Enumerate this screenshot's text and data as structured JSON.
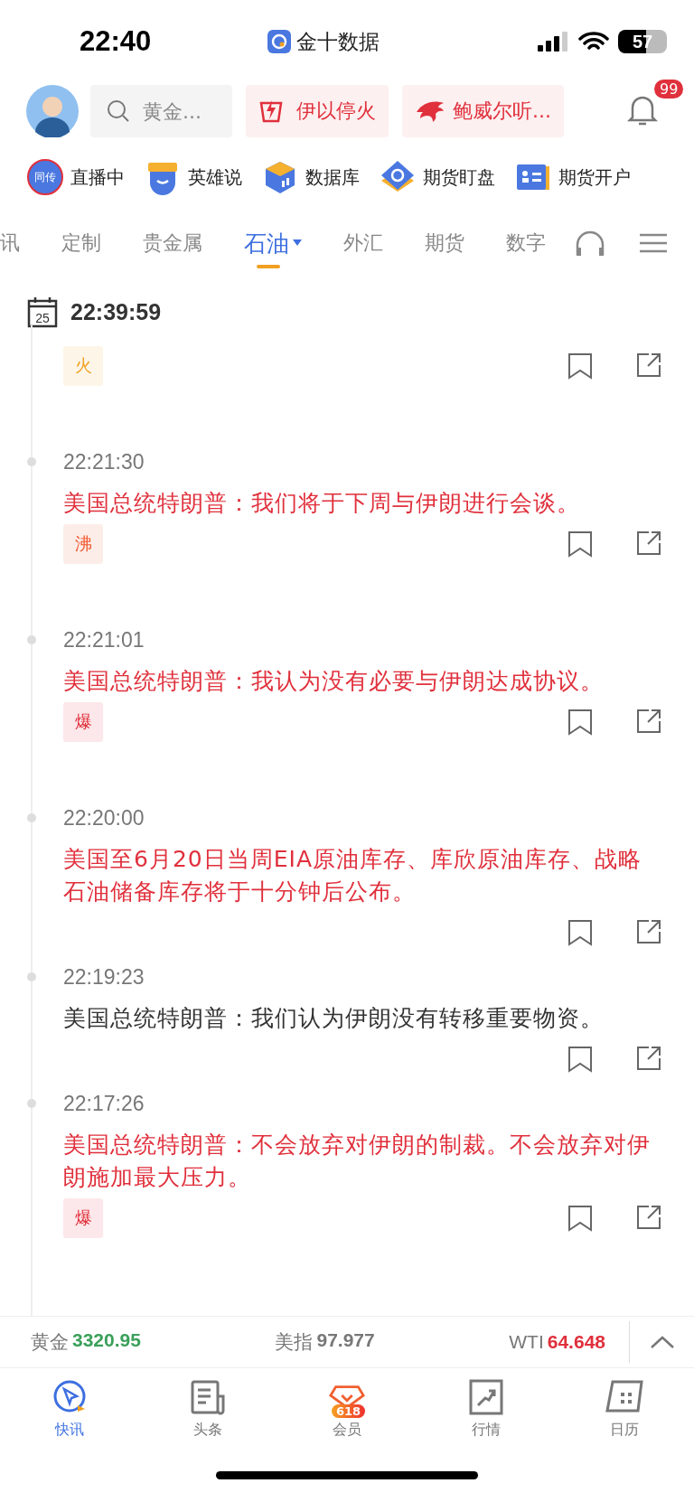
{
  "status_bar": {
    "time": "22:40",
    "app": "金十数据",
    "battery": "57"
  },
  "top_bar": {
    "search": {
      "placeholder": "黄金..."
    },
    "topics": [
      {
        "label": "伊以停火",
        "kind": "fire"
      },
      {
        "label": "鲍威尔听...",
        "kind": "eagle"
      }
    ],
    "notifications": "99"
  },
  "shortcuts": [
    {
      "label": "直播中",
      "kind": "live",
      "badge": "同传"
    },
    {
      "label": "英雄说",
      "kind": "hero"
    },
    {
      "label": "数据库",
      "kind": "database"
    },
    {
      "label": "期货盯盘",
      "kind": "watch"
    },
    {
      "label": "期货开户",
      "kind": "account"
    }
  ],
  "tabs": [
    {
      "label": "讯",
      "selected": false
    },
    {
      "label": "定制",
      "selected": false
    },
    {
      "label": "贵金属",
      "selected": false
    },
    {
      "label": "石油",
      "selected": true,
      "dropdown": true
    },
    {
      "label": "外汇",
      "selected": false
    },
    {
      "label": "期货",
      "selected": false
    },
    {
      "label": "数字",
      "selected": false
    }
  ],
  "feed": {
    "date": "25",
    "time": "22:39:59",
    "items": [
      {
        "tag": {
          "text": "火",
          "color": "#f0a020"
        }
      },
      {
        "time": "22:21:30",
        "text": "美国总统特朗普：我们将于下周与伊朗进行会谈。",
        "important": true,
        "tag": {
          "text": "沸",
          "color": "#f05a30"
        }
      },
      {
        "time": "22:21:01",
        "text": "美国总统特朗普：我认为没有必要与伊朗达成协议。",
        "important": true,
        "tag": {
          "text": "爆",
          "color": "#e0303c"
        }
      },
      {
        "time": "22:20:00",
        "text": "美国至6月20日当周EIA原油库存、库欣原油库存、战略石油储备库存将于十分钟后公布。",
        "important": true
      },
      {
        "time": "22:19:23",
        "text": "美国总统特朗普：我们认为伊朗没有转移重要物资。",
        "important": false
      },
      {
        "time": "22:17:26",
        "text": "美国总统特朗普：不会放弃对伊朗的制裁。不会放弃对伊朗施加最大压力。",
        "important": true,
        "tag": {
          "text": "爆",
          "color": "#e0303c"
        }
      }
    ]
  },
  "ticker": [
    {
      "name": "黄金",
      "value": "3320.95",
      "color": "#3aa05a"
    },
    {
      "name": "美指",
      "value": "97.977",
      "color": "#777777"
    },
    {
      "name": "WTI",
      "value": "64.648",
      "color": "#e0303c"
    }
  ],
  "nav": [
    {
      "label": "快讯",
      "kind": "flash",
      "selected": true
    },
    {
      "label": "头条",
      "kind": "news",
      "selected": false
    },
    {
      "label": "会员",
      "kind": "vip",
      "badge": "618",
      "selected": false
    },
    {
      "label": "行情",
      "kind": "market",
      "selected": false
    },
    {
      "label": "日历",
      "kind": "calendar",
      "selected": false
    }
  ]
}
